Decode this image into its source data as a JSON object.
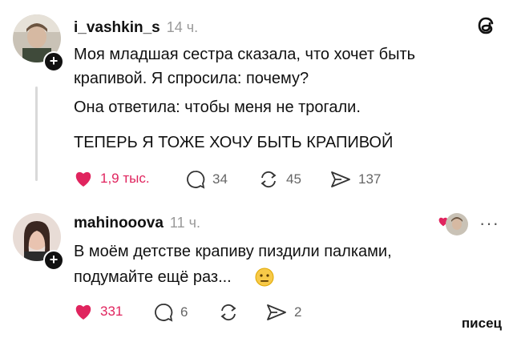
{
  "post": {
    "username": "i_vashkin_s",
    "time": "14 ч.",
    "lines": [
      "Моя младшая сестра сказала, что хочет быть",
      "крапивой. Я спросила: почему?",
      "Она ответила: чтобы меня не трогали.",
      "ТЕПЕРЬ Я ТОЖЕ ХОЧУ БЫТЬ КРАПИВОЙ"
    ],
    "likes": "1,9 тыс.",
    "comments": "34",
    "reposts": "45",
    "shares": "137"
  },
  "reply": {
    "username": "mahinooova",
    "time": "11 ч.",
    "lines": [
      "В моём детстве крапиву пиздили палками,",
      "подумайте ещё раз..."
    ],
    "likes": "331",
    "comments": "6",
    "shares": "2",
    "more": "···"
  },
  "watermark": "писец",
  "colors": {
    "like": "#e0245e",
    "muted": "#9a9a9a",
    "text": "#111111"
  }
}
